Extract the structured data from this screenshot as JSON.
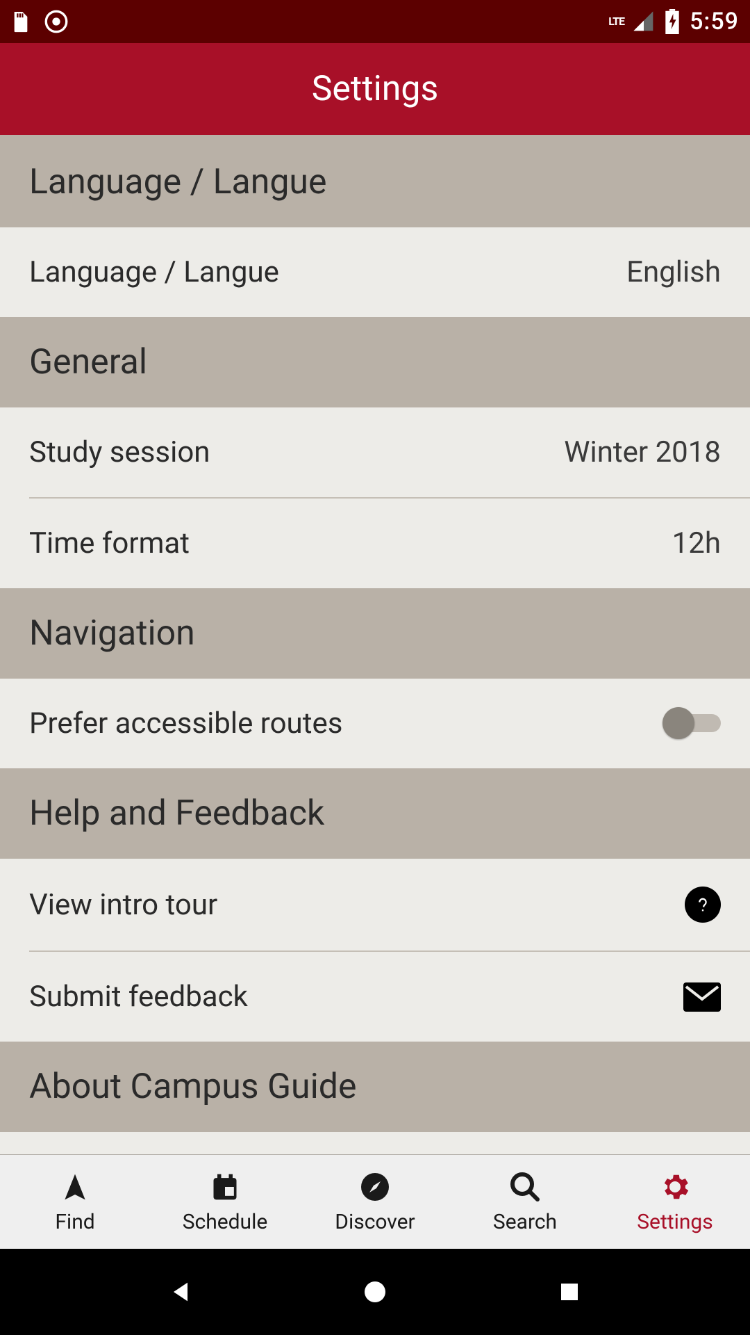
{
  "status": {
    "time": "5:59",
    "lte": "LTE"
  },
  "appbar": {
    "title": "Settings"
  },
  "sections": {
    "language": {
      "header": "Language / Langue",
      "item_label": "Language / Langue",
      "item_value": "English"
    },
    "general": {
      "header": "General",
      "study_label": "Study session",
      "study_value": "Winter 2018",
      "time_label": "Time format",
      "time_value": "12h"
    },
    "navigation": {
      "header": "Navigation",
      "accessible_label": "Prefer accessible routes",
      "accessible_on": false
    },
    "help": {
      "header": "Help and Feedback",
      "intro_label": "View intro tour",
      "feedback_label": "Submit feedback"
    },
    "about": {
      "header": "About Campus Guide"
    }
  },
  "nav": {
    "find": "Find",
    "schedule": "Schedule",
    "discover": "Discover",
    "search": "Search",
    "settings": "Settings"
  },
  "colors": {
    "status": "#5c0000",
    "appbar": "#a81028",
    "header_bg": "#b9b1a7",
    "content_bg": "#edece8",
    "active": "#a81028"
  }
}
